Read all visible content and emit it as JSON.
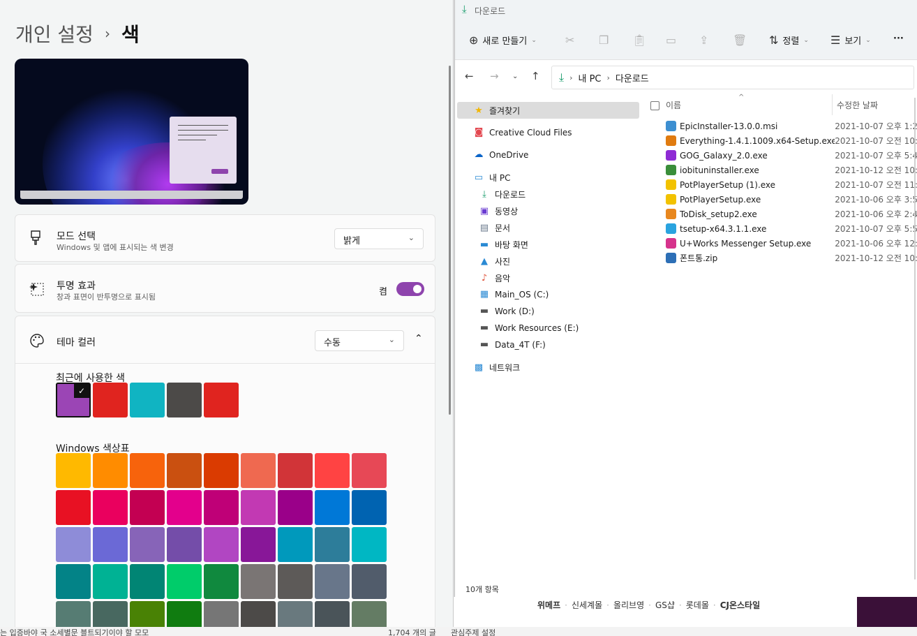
{
  "settings": {
    "breadcrumb": {
      "parent": "개인 설정",
      "current": "색"
    },
    "mode": {
      "title": "모드 선택",
      "subtitle": "Windows 및 앱에 표시되는 색 변경",
      "value": "밝게"
    },
    "transparency": {
      "title": "투명 효과",
      "subtitle": "창과 표면이 반투명으로 표시됨",
      "state_label": "켬"
    },
    "theme_color": {
      "title": "테마 컬러",
      "value": "수동"
    },
    "recent_label": "최근에 사용한 색",
    "recent_colors": [
      "#9b45b5",
      "#e0241f",
      "#10b4c2",
      "#4c4a48",
      "#e0241f"
    ],
    "palette_label": "Windows 색상표",
    "palette": [
      [
        "#ffb900",
        "#ff8c00",
        "#f7630c",
        "#ca5010",
        "#da3b01",
        "#ef6950",
        "#d13438",
        "#ff4343",
        "#e74856"
      ],
      [
        "#e81123",
        "#ea005e",
        "#c30052",
        "#e3008c",
        "#bf0077",
        "#c239b3",
        "#9a0089",
        "#0078d7",
        "#0063b1"
      ],
      [
        "#8e8cd8",
        "#6b69d6",
        "#8764b8",
        "#744da9",
        "#b146c2",
        "#881798",
        "#0099bc",
        "#2d7d9a",
        "#00b7c3"
      ],
      [
        "#038387",
        "#00b294",
        "#018574",
        "#00cc6a",
        "#10893e",
        "#7a7574",
        "#5d5a58",
        "#68768a",
        "#515c6b"
      ],
      [
        "#567c73",
        "#486860",
        "#498205",
        "#107c10",
        "#767676",
        "#4c4a48",
        "#69797e",
        "#4a5459",
        "#647c64"
      ]
    ]
  },
  "explorer": {
    "title": "다운로드",
    "toolbar": {
      "new": "새로 만들기",
      "sort": "정렬",
      "view": "보기",
      "more": "···"
    },
    "address": {
      "pc": "내 PC",
      "folder": "다운로드"
    },
    "nav": {
      "quick_access": "즐겨찾기",
      "creative_cloud": "Creative Cloud Files",
      "onedrive": "OneDrive",
      "this_pc": "내 PC",
      "downloads": "다운로드",
      "videos": "동영상",
      "documents": "문서",
      "desktop": "바탕 화면",
      "pictures": "사진",
      "music": "음악",
      "drive_c": "Main_OS (C:)",
      "drive_d": "Work (D:)",
      "drive_e": "Work Resources (E:)",
      "drive_f": "Data_4T (F:)",
      "network": "네트워크"
    },
    "columns": {
      "name": "이름",
      "date": "수정한 날짜"
    },
    "files": [
      {
        "name": "EpicInstaller-13.0.0.msi",
        "date": "2021-10-07 오후 1:2",
        "icon_color": "#3d8fd1"
      },
      {
        "name": "Everything-1.4.1.1009.x64-Setup.exe",
        "date": "2021-10-07 오전 10:",
        "icon_color": "#e07b10"
      },
      {
        "name": "GOG_Galaxy_2.0.exe",
        "date": "2021-10-07 오후 5:4",
        "icon_color": "#8e2bd4"
      },
      {
        "name": "iobituninstaller.exe",
        "date": "2021-10-12 오전 10:",
        "icon_color": "#3a8e3a"
      },
      {
        "name": "PotPlayerSetup (1).exe",
        "date": "2021-10-07 오전 11:",
        "icon_color": "#f2c200"
      },
      {
        "name": "PotPlayerSetup.exe",
        "date": "2021-10-06 오후 3:5",
        "icon_color": "#f2c200"
      },
      {
        "name": "ToDisk_setup2.exe",
        "date": "2021-10-06 오후 2:4",
        "icon_color": "#e8871e"
      },
      {
        "name": "tsetup-x64.3.1.1.exe",
        "date": "2021-10-07 오후 5:5",
        "icon_color": "#2aa3df"
      },
      {
        "name": "U+Works Messenger Setup.exe",
        "date": "2021-10-06 오후 12:",
        "icon_color": "#d6338c"
      },
      {
        "name": "폰트통.zip",
        "date": "2021-10-12 오전 10:",
        "icon_color": "#2d6fb6"
      }
    ],
    "status": "10개 항목"
  },
  "background": {
    "nav_links": [
      "위메프",
      "신세계몰",
      "올리브영",
      "GS샵",
      "롯데몰",
      "CJ온스타일"
    ],
    "bottom_left": "는 입증바야 국  소세별문 블트되기이야 할 모모",
    "bottom_mid": "1,704 개의 글",
    "bottom_right": "관심주제 설정"
  }
}
